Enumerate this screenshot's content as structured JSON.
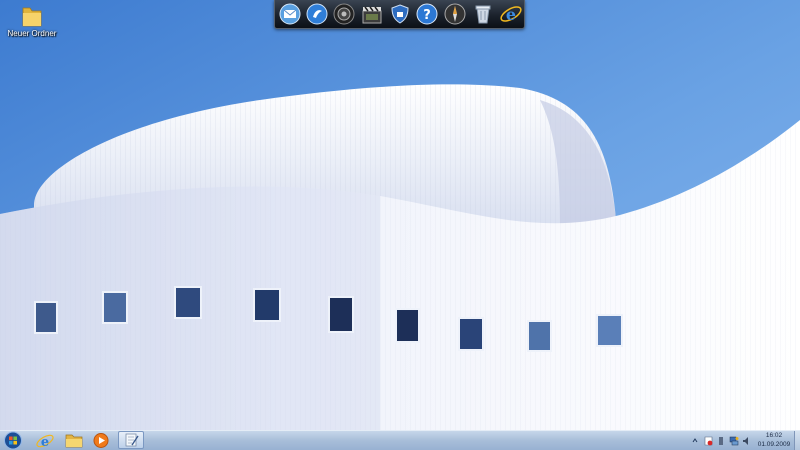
{
  "desktop": {
    "icons": [
      {
        "label": "Neuer Ordner",
        "icon": "folder-icon"
      }
    ]
  },
  "dock": {
    "items": [
      "mail-icon",
      "messenger-icon",
      "speaker-icon",
      "movie-clapper-icon",
      "shield-icon",
      "help-icon",
      "compass-icon",
      "recycle-bin-icon",
      "internet-explorer-icon"
    ]
  },
  "taskbar": {
    "pinned": [
      "start-orb-icon",
      "internet-explorer-icon",
      "folder-icon",
      "media-player-icon",
      "notepad-icon"
    ],
    "tray": [
      "show-hidden-arrow-icon",
      "action-center-icon",
      "usb-icon",
      "network-icon",
      "volume-icon"
    ],
    "clock": {
      "time": "16:02",
      "date": "01.09.2009"
    }
  },
  "colors": {
    "sky": "#3f7ed2",
    "building": "#e8ecf6",
    "taskbar": "#a8bed9",
    "dock": "#1b222c"
  }
}
